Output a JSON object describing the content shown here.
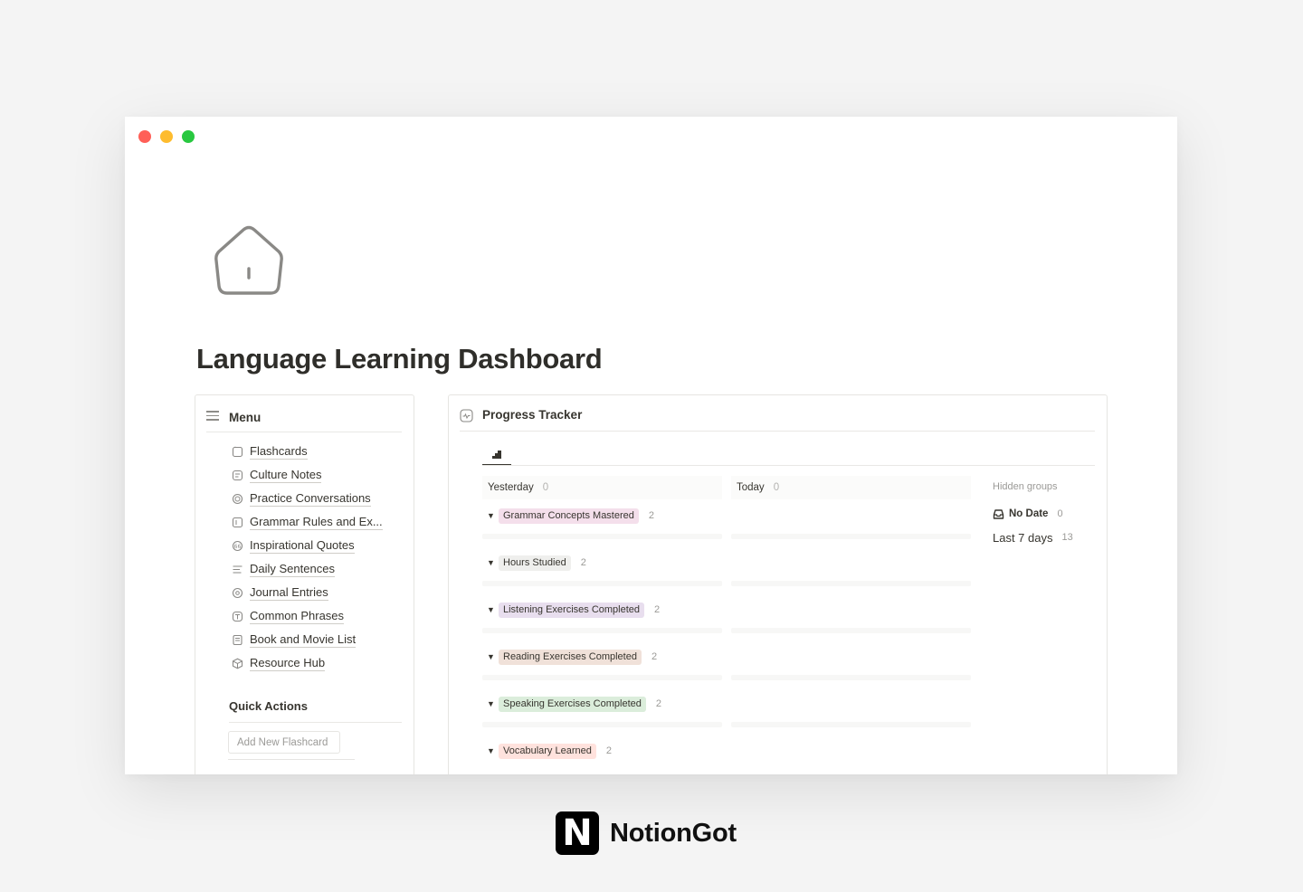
{
  "page": {
    "icon": "house-icon",
    "title": "Language Learning Dashboard"
  },
  "menu": {
    "title": "Menu",
    "items": [
      {
        "label": "Flashcards",
        "icon": "flashcard-icon"
      },
      {
        "label": "Culture Notes",
        "icon": "notes-icon"
      },
      {
        "label": "Practice Conversations",
        "icon": "chat-icon"
      },
      {
        "label": "Grammar Rules and Ex...",
        "icon": "grammar-icon"
      },
      {
        "label": "Inspirational Quotes",
        "icon": "quote-icon"
      },
      {
        "label": "Daily Sentences",
        "icon": "text-lines-icon"
      },
      {
        "label": "Journal Entries",
        "icon": "journal-icon"
      },
      {
        "label": "Common Phrases",
        "icon": "phrase-icon"
      },
      {
        "label": "Book and Movie List",
        "icon": "book-icon"
      },
      {
        "label": "Resource Hub",
        "icon": "cube-icon"
      }
    ]
  },
  "quick_actions": {
    "title": "Quick Actions",
    "add_flashcard_label": "Add New Flashcard"
  },
  "progress_tracker": {
    "title": "Progress Tracker",
    "view_icon": "chart-icon",
    "columns": [
      {
        "name": "Yesterday",
        "count": "0"
      },
      {
        "name": "Today",
        "count": "0"
      }
    ],
    "groups": [
      {
        "label": "Grammar Concepts Mastered",
        "count": "2",
        "color": "#f4dfeb"
      },
      {
        "label": "Hours Studied",
        "count": "2",
        "color": "#efefed"
      },
      {
        "label": "Listening Exercises Completed",
        "count": "2",
        "color": "#e8deee"
      },
      {
        "label": "Reading Exercises Completed",
        "count": "2",
        "color": "#f0e1d9"
      },
      {
        "label": "Speaking Exercises Completed",
        "count": "2",
        "color": "#dbeddb"
      },
      {
        "label": "Vocabulary Learned",
        "count": "2",
        "color": "#ffe2dd"
      }
    ],
    "hidden_groups": {
      "title": "Hidden groups",
      "items": [
        {
          "name": "No Date",
          "count": "0",
          "icon": "inbox-icon"
        },
        {
          "name": "Last 7 days",
          "count": "13"
        }
      ]
    }
  },
  "brand": {
    "logo_letter": "N",
    "name": "NotionGot"
  },
  "colors": {
    "traffic_red": "#ff5f57",
    "traffic_yellow": "#febc2e",
    "traffic_green": "#28c840",
    "text": "#37352f"
  }
}
